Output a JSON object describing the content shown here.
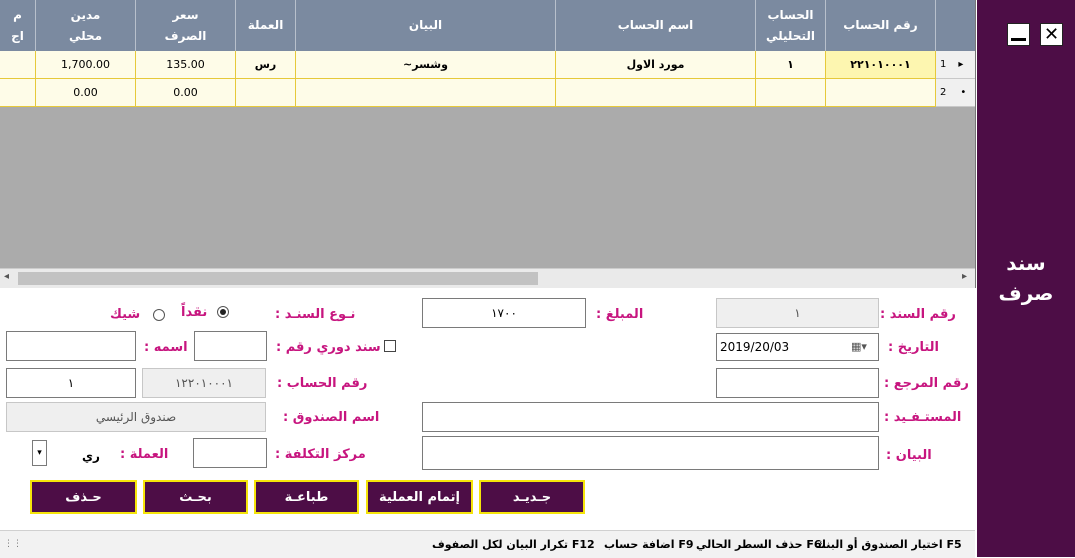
{
  "window": {
    "title": "سند صرف"
  },
  "grid": {
    "columns": [
      "رقم الحساب",
      "الحساب\nالتحليلي",
      "اسم الحساب",
      "البيان",
      "العملة",
      "سعر\nالصرف",
      "مدين\nمحلي",
      "م\nاج"
    ],
    "rows": [
      {
        "num": "1",
        "marker": "▸",
        "account_no": "٢٢١٠١٠٠٠١",
        "analytical": "١",
        "account_name": "مورد الاول",
        "statement": "~وشسر",
        "currency": "رس",
        "rate": "135.00",
        "debit": "1,700.00"
      },
      {
        "num": "2",
        "marker": "•",
        "account_no": "",
        "analytical": "",
        "account_name": "",
        "statement": "",
        "currency": "",
        "rate": "0.00",
        "debit": "0.00"
      }
    ],
    "scroll_left": "◂",
    "scroll_right": "▸"
  },
  "form": {
    "voucher_no_label": "رقم السند :",
    "voucher_no": "١",
    "amount_label": "المبلغ :",
    "amount": "١٧٠٠",
    "voucher_type_label": "نـوع السنـد :",
    "cash_label": "نقداً",
    "check_label": "شيك",
    "payment_type": "cash",
    "date_label": "التاريخ :",
    "date": "2019/20/03",
    "periodic_label": "سند دوري رقم :",
    "periodic_no": "",
    "name_label": "اسمه :",
    "name_value": "",
    "ref_label": "رقم المرجع :",
    "ref_value": "",
    "account_label": "رقم الحساب :",
    "account_no": "١٢٢٠١٠٠٠١",
    "account_sub": "١",
    "beneficiary_label": "المستـفـيد :",
    "beneficiary": "",
    "fund_label": "اسم الصندوق :",
    "fund_name": "صندوق الرئيسي",
    "statement_label": "البيان :",
    "statement": "",
    "cost_center_label": "مركز التكلفة :",
    "cost_center": "",
    "currency_label": "العملة :",
    "currency_value": "ري"
  },
  "buttons": {
    "new": "جـديـد",
    "complete": "إتمام العملية",
    "print": "طباعـة",
    "search": "بحـث",
    "delete": "حـذف"
  },
  "status": {
    "f5": "F5 اختيار الصندوق أو البنك",
    "f6": "F6 حذف السطر الحالي",
    "f9": "F9 اضافة حساب",
    "f12": "F12 تكرار البيان لكل الصفوف"
  },
  "colors": {
    "panel": "#4d0d46",
    "label": "#c7157f",
    "header": "#7b8aa0",
    "button_border": "#f5e40a"
  }
}
